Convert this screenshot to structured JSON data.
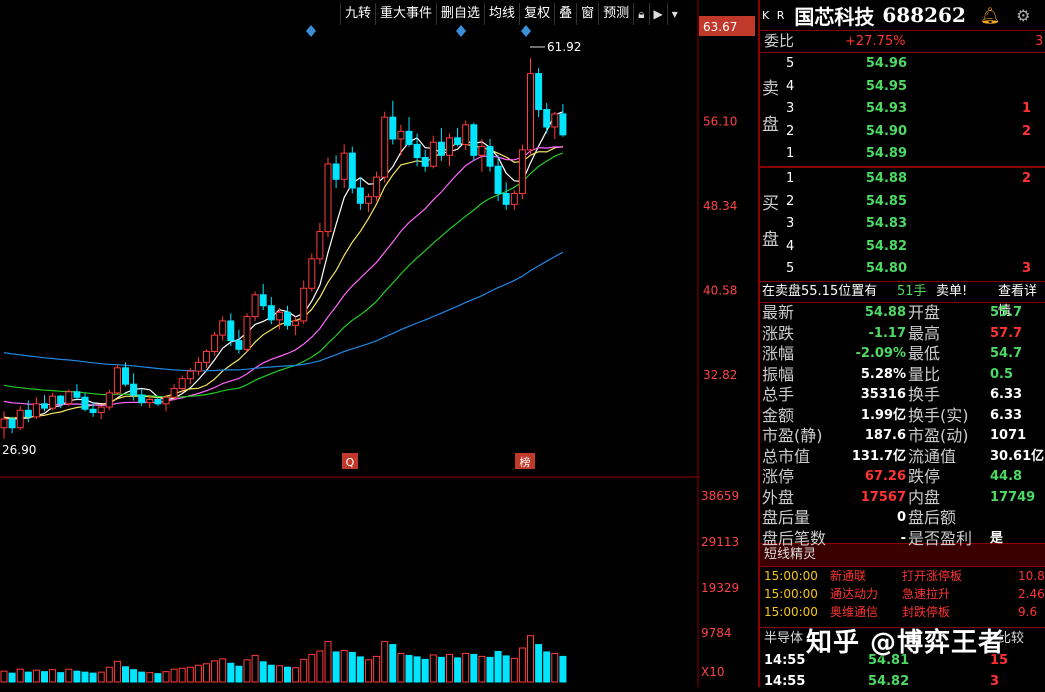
{
  "toolbar": {
    "items": [
      "九转",
      "重大事件",
      "删自选",
      "均线",
      "复权",
      "叠",
      "窗",
      "预测"
    ],
    "lock_icon": "lock-icon",
    "pin_icon": "pin-icon",
    "dropdown_icon": "chevron-down-icon"
  },
  "stock": {
    "exchange_tag": "K R",
    "name": "国芯科技",
    "code": "688262"
  },
  "weibi": {
    "label": "委比",
    "value": "+27.75%",
    "right": "3"
  },
  "sell": {
    "side_labels": [
      "卖",
      "盘"
    ],
    "rows": [
      {
        "level": "5",
        "price": "54.96",
        "vol": ""
      },
      {
        "level": "4",
        "price": "54.95",
        "vol": ""
      },
      {
        "level": "3",
        "price": "54.93",
        "vol": "1"
      },
      {
        "level": "2",
        "price": "54.90",
        "vol": "2"
      },
      {
        "level": "1",
        "price": "54.89",
        "vol": ""
      }
    ]
  },
  "buy": {
    "side_labels": [
      "买",
      "盘"
    ],
    "rows": [
      {
        "level": "1",
        "price": "54.88",
        "vol": "2"
      },
      {
        "level": "2",
        "price": "54.85",
        "vol": ""
      },
      {
        "level": "3",
        "price": "54.83",
        "vol": ""
      },
      {
        "level": "4",
        "price": "54.82",
        "vol": ""
      },
      {
        "level": "5",
        "price": "54.80",
        "vol": "3"
      }
    ]
  },
  "notice": {
    "text1": "在卖盘55.15位置有",
    "qty": "51手",
    "text2": "卖单!",
    "link": "查看详情"
  },
  "stats": [
    {
      "l1": "最新",
      "v1": "54.88",
      "c1": "green",
      "l2": "开盘",
      "v2": "55.7",
      "c2": "green"
    },
    {
      "l1": "涨跌",
      "v1": "-1.17",
      "c1": "green",
      "l2": "最高",
      "v2": "57.7",
      "c2": "red"
    },
    {
      "l1": "涨幅",
      "v1": "-2.09%",
      "c1": "green",
      "l2": "最低",
      "v2": "54.7",
      "c2": "green"
    },
    {
      "l1": "振幅",
      "v1": "5.28%",
      "c1": "white",
      "l2": "量比",
      "v2": "0.5",
      "c2": "green"
    },
    {
      "l1": "总手",
      "v1": "35316",
      "c1": "white",
      "l2": "换手",
      "v2": "6.33",
      "c2": "white"
    },
    {
      "l1": "金额",
      "v1": "1.99亿",
      "c1": "white",
      "l2": "换手(实)",
      "v2": "6.33",
      "c2": "white"
    },
    {
      "l1": "市盈(静)",
      "v1": "187.6",
      "c1": "white",
      "l2": "市盈(动)",
      "v2": "1071",
      "c2": "white"
    },
    {
      "l1": "总市值",
      "v1": "131.7亿",
      "c1": "white",
      "l2": "流通值",
      "v2": "30.61亿",
      "c2": "white"
    },
    {
      "l1": "涨停",
      "v1": "67.26",
      "c1": "red",
      "l2": "跌停",
      "v2": "44.8",
      "c2": "green"
    },
    {
      "l1": "外盘",
      "v1": "17567",
      "c1": "red",
      "l2": "内盘",
      "v2": "17749",
      "c2": "green"
    },
    {
      "l1": "盘后量",
      "v1": "0",
      "c1": "white",
      "l2": "盘后额",
      "v2": "",
      "c2": "white"
    },
    {
      "l1": "盘后笔数",
      "v1": "-",
      "c1": "white",
      "l2": "是否盈利",
      "v2": "是",
      "c2": "white"
    }
  ],
  "sprite": {
    "title": "短线精灵",
    "rows": [
      {
        "time": "15:00:00",
        "name": "新通联",
        "event": "打开涨停板",
        "val": "10.8"
      },
      {
        "time": "15:00:00",
        "name": "通达动力",
        "event": "急速拉升",
        "val": "2.46"
      },
      {
        "time": "15:00:00",
        "name": "奥维通信",
        "event": "封跌停板",
        "val": "9.6"
      }
    ]
  },
  "ticks": {
    "title": "半导体",
    "title_right": "比较",
    "rows": [
      {
        "time": "14:55",
        "price": "54.81",
        "vol": "15"
      },
      {
        "time": "14:55",
        "price": "54.82",
        "vol": "3"
      }
    ]
  },
  "watermark": "知乎 @博弈王者",
  "chart_labels": {
    "price_axis": [
      "63.67",
      "56.10",
      "48.34",
      "40.58",
      "32.82"
    ],
    "volume_axis": [
      "38659",
      "29113",
      "19329",
      "9784",
      "X10"
    ],
    "high_label": "61.92",
    "low_label": "26.90",
    "markers": [
      "Q",
      "榜"
    ]
  },
  "chart_data": {
    "type": "candlestick",
    "ylim": [
      25.5,
      64.5
    ],
    "volume_ylim": [
      0,
      40000
    ],
    "ma_colors": [
      "#ffffff",
      "#f5e663",
      "#ff66ff",
      "#22cc22",
      "#1e88e5"
    ],
    "candles": [
      [
        28.0,
        29.5,
        27.0,
        28.8
      ],
      [
        28.8,
        29.0,
        27.5,
        28.0
      ],
      [
        28.0,
        30.0,
        27.8,
        29.6
      ],
      [
        29.6,
        30.5,
        28.5,
        29.0
      ],
      [
        29.0,
        30.8,
        28.8,
        30.2
      ],
      [
        30.2,
        31.0,
        29.5,
        29.8
      ],
      [
        29.8,
        31.2,
        29.6,
        30.9
      ],
      [
        30.9,
        31.0,
        29.8,
        30.2
      ],
      [
        30.2,
        31.5,
        30.0,
        31.3
      ],
      [
        31.3,
        32.0,
        30.6,
        30.8
      ],
      [
        30.8,
        31.2,
        29.5,
        29.7
      ],
      [
        29.7,
        30.3,
        29.0,
        29.4
      ],
      [
        29.4,
        30.0,
        28.8,
        29.9
      ],
      [
        29.9,
        31.5,
        29.6,
        31.2
      ],
      [
        31.2,
        33.8,
        31.0,
        33.5
      ],
      [
        33.5,
        34.0,
        31.8,
        32.0
      ],
      [
        32.0,
        33.0,
        30.5,
        31.0
      ],
      [
        31.0,
        31.6,
        30.0,
        30.3
      ],
      [
        30.3,
        31.0,
        29.8,
        30.6
      ],
      [
        30.6,
        30.9,
        30.0,
        30.2
      ],
      [
        30.2,
        31.0,
        29.5,
        30.8
      ],
      [
        30.8,
        32.0,
        30.5,
        31.6
      ],
      [
        31.6,
        32.8,
        31.2,
        32.5
      ],
      [
        32.5,
        33.5,
        32.0,
        33.2
      ],
      [
        33.2,
        34.5,
        32.8,
        34.0
      ],
      [
        34.0,
        35.2,
        33.5,
        35.0
      ],
      [
        35.0,
        36.8,
        34.6,
        36.5
      ],
      [
        36.5,
        38.2,
        36.0,
        37.8
      ],
      [
        37.8,
        38.5,
        35.5,
        36.0
      ],
      [
        36.0,
        37.0,
        34.8,
        35.2
      ],
      [
        35.2,
        38.5,
        35.0,
        38.2
      ],
      [
        38.2,
        40.5,
        37.8,
        40.2
      ],
      [
        40.2,
        41.2,
        38.8,
        39.2
      ],
      [
        39.2,
        40.0,
        37.5,
        37.9
      ],
      [
        37.9,
        39.0,
        37.0,
        38.6
      ],
      [
        38.6,
        39.2,
        37.0,
        37.4
      ],
      [
        37.4,
        38.2,
        36.5,
        37.8
      ],
      [
        37.8,
        41.5,
        37.5,
        40.8
      ],
      [
        40.8,
        44.0,
        40.5,
        43.5
      ],
      [
        43.5,
        46.8,
        43.0,
        46.0
      ],
      [
        46.0,
        52.8,
        45.5,
        52.2
      ],
      [
        52.2,
        53.0,
        50.0,
        50.8
      ],
      [
        50.8,
        54.0,
        50.0,
        53.2
      ],
      [
        53.2,
        53.8,
        49.5,
        50.0
      ],
      [
        50.0,
        51.0,
        48.0,
        48.6
      ],
      [
        48.6,
        49.5,
        47.8,
        49.2
      ],
      [
        49.2,
        51.5,
        48.8,
        51.0
      ],
      [
        51.0,
        57.0,
        50.5,
        56.5
      ],
      [
        56.5,
        58.0,
        54.0,
        54.5
      ],
      [
        54.5,
        55.8,
        53.0,
        55.2
      ],
      [
        55.2,
        56.5,
        53.8,
        54.0
      ],
      [
        54.0,
        55.0,
        52.0,
        52.8
      ],
      [
        52.8,
        53.5,
        51.5,
        52.0
      ],
      [
        52.0,
        54.8,
        51.8,
        54.2
      ],
      [
        54.2,
        55.5,
        52.5,
        53.0
      ],
      [
        53.0,
        55.0,
        52.0,
        54.6
      ],
      [
        54.6,
        55.5,
        53.8,
        54.0
      ],
      [
        54.0,
        56.2,
        53.5,
        55.8
      ],
      [
        55.8,
        56.0,
        52.5,
        53.0
      ],
      [
        53.0,
        54.5,
        51.5,
        53.8
      ],
      [
        53.8,
        54.5,
        51.5,
        52.0
      ],
      [
        52.0,
        53.0,
        48.8,
        49.5
      ],
      [
        49.5,
        50.5,
        48.0,
        48.5
      ],
      [
        48.5,
        49.8,
        48.0,
        49.5
      ],
      [
        49.5,
        54.0,
        49.0,
        53.5
      ],
      [
        53.5,
        61.92,
        53.0,
        60.5
      ],
      [
        60.5,
        61.0,
        56.5,
        57.2
      ],
      [
        57.2,
        57.8,
        55.0,
        55.6
      ],
      [
        55.6,
        57.0,
        54.5,
        56.8
      ],
      [
        56.8,
        57.7,
        54.7,
        54.88
      ]
    ],
    "volumes": [
      2200,
      1800,
      2600,
      2000,
      2400,
      2100,
      2500,
      1900,
      2600,
      2200,
      2000,
      1800,
      2000,
      3000,
      4200,
      3100,
      2500,
      2000,
      1900,
      1700,
      2100,
      2600,
      2800,
      3000,
      3400,
      3700,
      4300,
      4700,
      3800,
      3200,
      4500,
      5400,
      4100,
      3400,
      3300,
      3000,
      2900,
      4600,
      5600,
      6300,
      8200,
      6100,
      6400,
      6000,
      5100,
      4500,
      5200,
      8200,
      7600,
      5800,
      5400,
      5100,
      4600,
      5500,
      5000,
      5600,
      4900,
      5800,
      5600,
      5200,
      5000,
      6200,
      5300,
      4800,
      6900,
      9400,
      7600,
      6100,
      5800,
      5200
    ]
  }
}
